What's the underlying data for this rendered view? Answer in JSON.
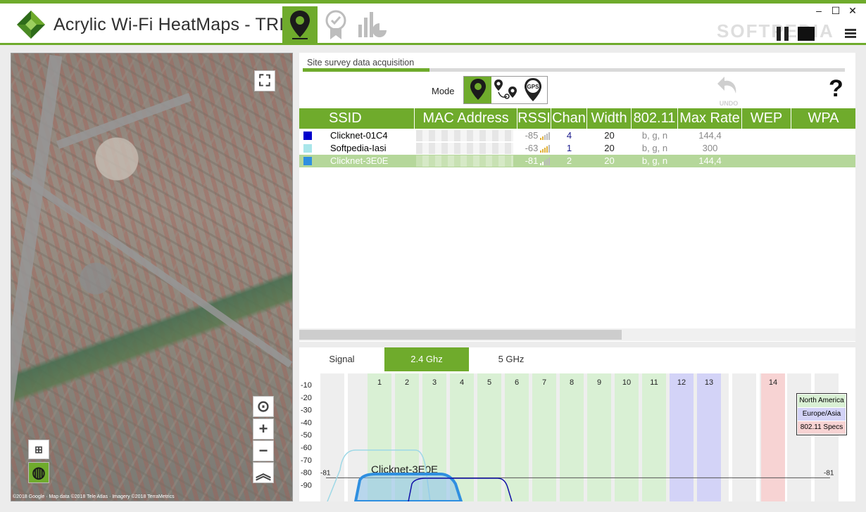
{
  "app": {
    "title": "Acrylic Wi-Fi HeatMaps - TRIAL",
    "watermark": "SOFTPEDIA",
    "accent_color": "#6fab2c",
    "window_controls": [
      "–",
      "☐",
      "✕"
    ],
    "mode_tabs": [
      {
        "name": "site-survey-pin-icon",
        "active": true
      },
      {
        "name": "certificate-badge-icon",
        "active": false
      },
      {
        "name": "reports-chart-icon",
        "active": false
      }
    ]
  },
  "map": {
    "attribution": "©2018 Google · Map data ©2018 Tele Atlas · Imagery ©2018 TerraMetrics"
  },
  "survey": {
    "section_title": "Site survey data acquisition",
    "mode_label": "Mode",
    "undo_label": "UNDO",
    "help_label": "?",
    "columns": [
      "SSID",
      "MAC Address",
      "RSSI",
      "Chan",
      "Width",
      "802.11",
      "Max Rate",
      "WEP",
      "WPA"
    ],
    "rows": [
      {
        "color": "#0000cc",
        "ssid": "Clicknet-01C4",
        "rssi": "-85",
        "chan": "4",
        "width": "20",
        "std": "b, g, n",
        "rate": "144,4",
        "signal_bars": 1,
        "selected": false
      },
      {
        "color": "#a9e6ea",
        "ssid": "Softpedia-Iasi",
        "rssi": "-63",
        "chan": "1",
        "width": "20",
        "std": "b, g, n",
        "rate": "300",
        "signal_bars": 3,
        "selected": false
      },
      {
        "color": "#2f8fe0",
        "ssid": "Clicknet-3E0E",
        "rssi": "-81",
        "chan": "2",
        "width": "20",
        "std": "b, g, n",
        "rate": "144,4",
        "signal_bars": 1,
        "selected": true
      }
    ]
  },
  "spectrum": {
    "tabs": [
      "Signal",
      "2.4 Ghz",
      "5 GHz"
    ],
    "active_tab": "2.4 Ghz",
    "legend": [
      "North America",
      "Europe/Asia",
      "802.11 Specs"
    ],
    "legend_colors": [
      "#d9f0d4",
      "#d3d3f7",
      "#f7d3d3"
    ],
    "y_ticks": [
      "-10",
      "-20",
      "-30",
      "-40",
      "-50",
      "-60",
      "-70",
      "-80",
      "-90"
    ],
    "channels": [
      "1",
      "2",
      "3",
      "4",
      "5",
      "6",
      "7",
      "8",
      "9",
      "10",
      "11",
      "12",
      "13",
      "14"
    ],
    "threshold_left": "-81",
    "threshold_right": "-81",
    "selected_label": "Clicknet-3E0E"
  }
}
